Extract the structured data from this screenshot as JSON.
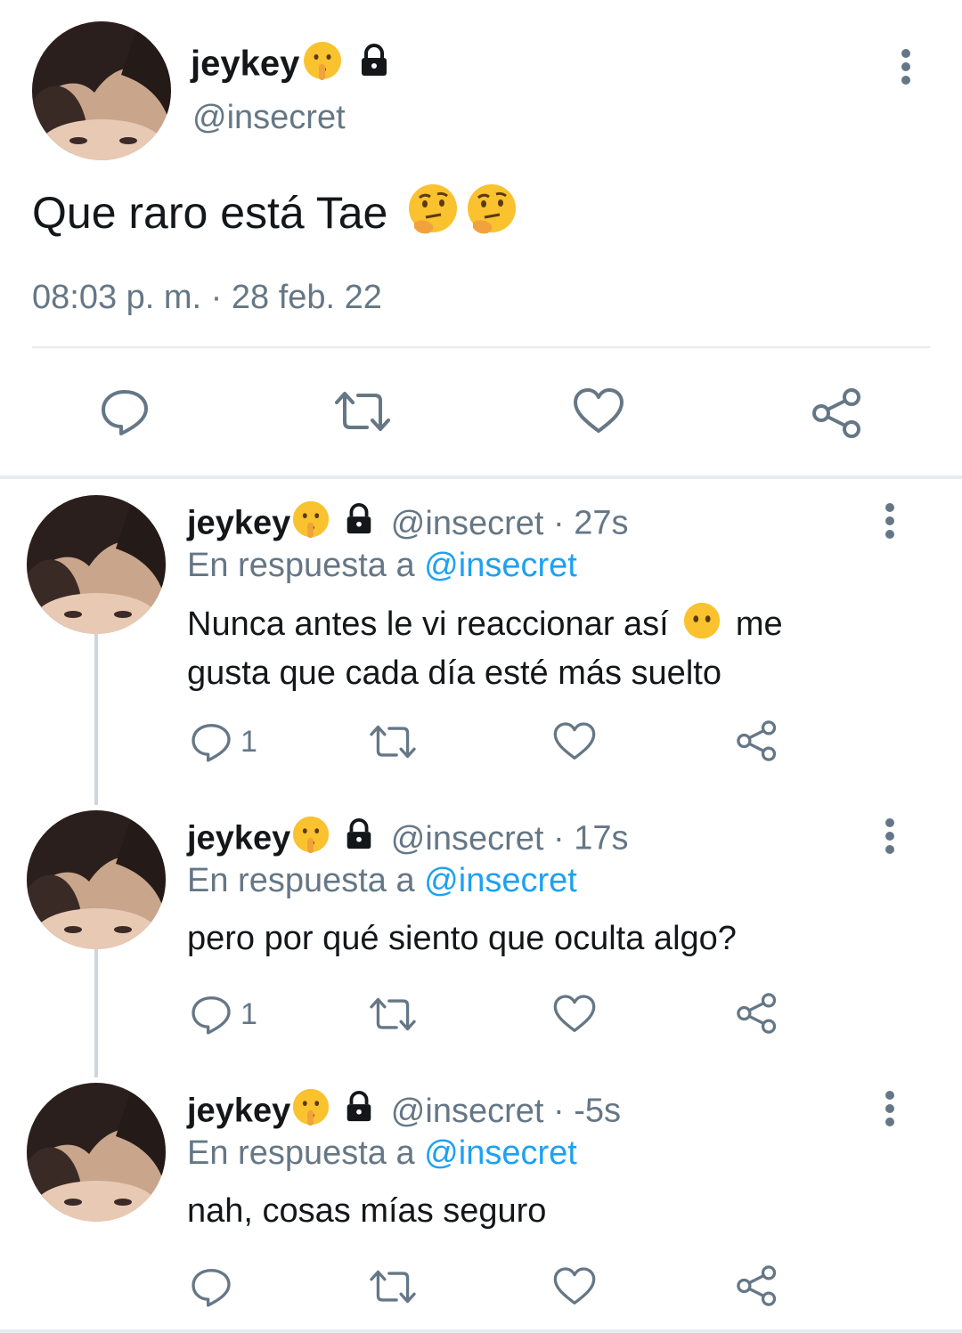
{
  "main_tweet": {
    "display_name": "jeykey",
    "handle": "@insecret",
    "text": "Que raro está Tae",
    "timestamp": "08:03 p. m. · 28 feb. 22"
  },
  "replies": [
    {
      "display_name": "jeykey",
      "handle": "@insecret",
      "time": "· 27s",
      "reply_prefix": "En respuesta a",
      "reply_to": "@insecret",
      "text_line1": "Nunca antes le vi reaccionar así",
      "text_line1_after": "me",
      "text_line2": "gusta que cada día esté más suelto",
      "reply_count": "1"
    },
    {
      "display_name": "jeykey",
      "handle": "@insecret",
      "time": "· 17s",
      "reply_prefix": "En respuesta a",
      "reply_to": "@insecret",
      "text_line1": "pero por qué siento que oculta algo?",
      "reply_count": "1"
    },
    {
      "display_name": "jeykey",
      "handle": "@insecret",
      "time": "· -5s",
      "reply_prefix": "En respuesta a",
      "reply_to": "@insecret",
      "text_line1": "nah, cosas mías seguro",
      "reply_count": ""
    }
  ],
  "colors": {
    "text": "#14171a",
    "secondary": "#657786",
    "link": "#1da1f2",
    "divider": "#e6ecf0"
  },
  "icons": [
    "more-vertical-icon",
    "lock-icon",
    "shushing-face-emoji",
    "thinking-face-emoji",
    "no-mouth-face-emoji",
    "reply-icon",
    "retweet-icon",
    "like-icon",
    "share-icon"
  ]
}
